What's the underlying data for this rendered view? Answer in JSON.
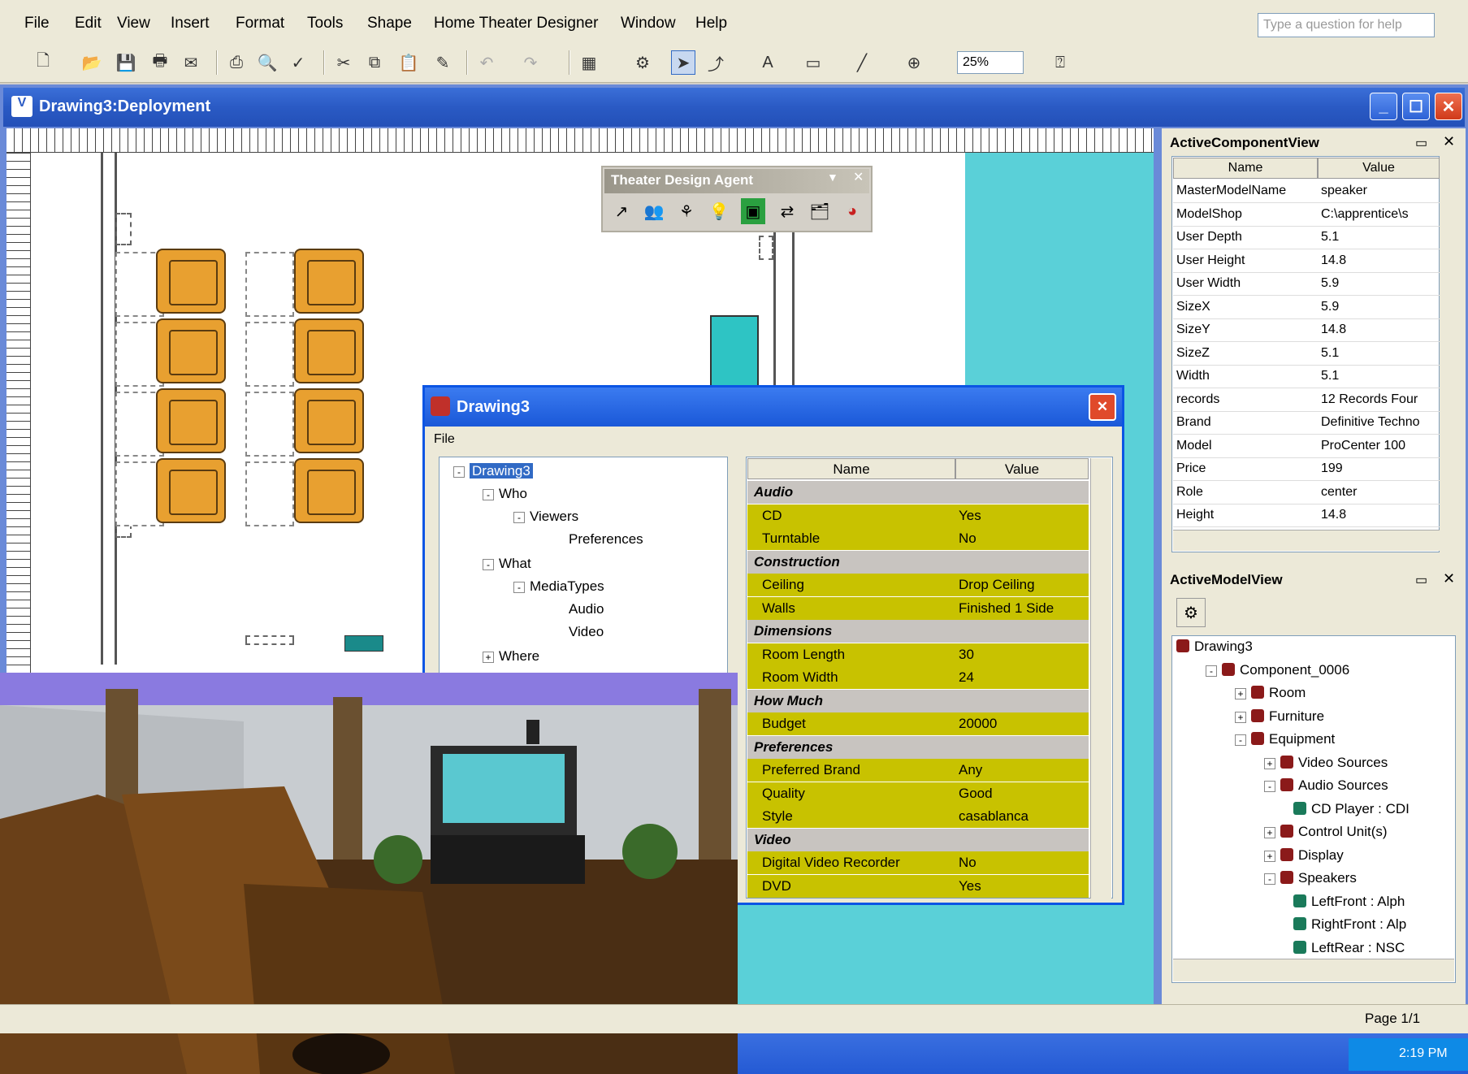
{
  "menubar": {
    "items": [
      "File",
      "Edit",
      "View",
      "Insert",
      "Format",
      "Tools",
      "Shape",
      "Home Theater Designer",
      "Window",
      "Help"
    ],
    "help_placeholder": "Type a question for help"
  },
  "toolbar": {
    "zoom": "25%",
    "icons": [
      "new-icon",
      "open-icon",
      "save-icon",
      "print-icon",
      "preview-icon",
      "cut-icon",
      "copy-icon",
      "paste-icon",
      "undo-icon",
      "redo-icon",
      "pointer-icon",
      "connector-icon",
      "text-icon",
      "rectangle-icon",
      "line-icon",
      "stamp-icon"
    ]
  },
  "document": {
    "title": "Drawing3:Deployment"
  },
  "agent": {
    "title": "Theater Design Agent"
  },
  "dialog": {
    "title": "Drawing3",
    "menu": "File",
    "tree": {
      "root": "Drawing3",
      "who": "Who",
      "viewers": "Viewers",
      "preferences": "Preferences",
      "what": "What",
      "mediatypes": "MediaTypes",
      "audio": "Audio",
      "video": "Video",
      "where": "Where"
    },
    "grid_headers": {
      "name": "Name",
      "value": "Value"
    },
    "rows": [
      {
        "type": "cat",
        "name": "Audio",
        "value": ""
      },
      {
        "type": "item",
        "name": "CD",
        "value": "Yes"
      },
      {
        "type": "item",
        "name": "Turntable",
        "value": "No"
      },
      {
        "type": "cat",
        "name": "Construction",
        "value": ""
      },
      {
        "type": "item",
        "name": "Ceiling",
        "value": "Drop Ceiling"
      },
      {
        "type": "item",
        "name": "Walls",
        "value": "Finished 1 Side"
      },
      {
        "type": "cat",
        "name": "Dimensions",
        "value": ""
      },
      {
        "type": "item",
        "name": "Room Length",
        "value": "30"
      },
      {
        "type": "item",
        "name": "Room Width",
        "value": "24"
      },
      {
        "type": "cat",
        "name": "How Much",
        "value": ""
      },
      {
        "type": "item",
        "name": "Budget",
        "value": "20000"
      },
      {
        "type": "cat",
        "name": "Preferences",
        "value": ""
      },
      {
        "type": "item",
        "name": "Preferred Brand",
        "value": "Any"
      },
      {
        "type": "item",
        "name": "Quality",
        "value": "Good"
      },
      {
        "type": "item",
        "name": "Style",
        "value": "casablanca"
      },
      {
        "type": "cat",
        "name": "Video",
        "value": ""
      },
      {
        "type": "item",
        "name": "Digital Video Recorder",
        "value": "No"
      },
      {
        "type": "item",
        "name": "DVD",
        "value": "Yes"
      }
    ]
  },
  "component_view": {
    "title": "ActiveComponentView",
    "headers": {
      "name": "Name",
      "value": "Value"
    },
    "rows": [
      {
        "name": "MasterModelName",
        "value": "speaker"
      },
      {
        "name": "ModelShop",
        "value": "C:\\apprentice\\s"
      },
      {
        "name": "User Depth",
        "value": "5.1"
      },
      {
        "name": "User Height",
        "value": "14.8"
      },
      {
        "name": "User Width",
        "value": "5.9"
      },
      {
        "name": "SizeX",
        "value": "5.9"
      },
      {
        "name": "SizeY",
        "value": "14.8"
      },
      {
        "name": "SizeZ",
        "value": "5.1"
      },
      {
        "name": "Width",
        "value": "5.1"
      },
      {
        "name": "records",
        "value": "12 Records Four"
      },
      {
        "name": "Brand",
        "value": "Definitive Techno"
      },
      {
        "name": "Model",
        "value": "ProCenter 100"
      },
      {
        "name": "Price",
        "value": "199"
      },
      {
        "name": "Role",
        "value": "center"
      },
      {
        "name": "Height",
        "value": "14.8"
      }
    ]
  },
  "model_view": {
    "title": "ActiveModelView",
    "nodes": [
      {
        "label": "Drawing3",
        "depth": 0,
        "exp": ""
      },
      {
        "label": "Component_0006",
        "depth": 1,
        "exp": "-"
      },
      {
        "label": "Room",
        "depth": 2,
        "exp": "+"
      },
      {
        "label": "Furniture",
        "depth": 2,
        "exp": "+"
      },
      {
        "label": "Equipment",
        "depth": 2,
        "exp": "-"
      },
      {
        "label": "Video Sources",
        "depth": 3,
        "exp": "+"
      },
      {
        "label": "Audio Sources",
        "depth": 3,
        "exp": "-"
      },
      {
        "label": "CD Player : CDI",
        "depth": 4,
        "exp": ""
      },
      {
        "label": "Control Unit(s)",
        "depth": 3,
        "exp": "+"
      },
      {
        "label": "Display",
        "depth": 3,
        "exp": "+"
      },
      {
        "label": "Speakers",
        "depth": 3,
        "exp": "-"
      },
      {
        "label": "LeftFront : Alph",
        "depth": 4,
        "exp": ""
      },
      {
        "label": "RightFront : Alp",
        "depth": 4,
        "exp": ""
      },
      {
        "label": "LeftRear : NSC",
        "depth": 4,
        "exp": ""
      }
    ]
  },
  "status": {
    "page": "Page 1/1"
  },
  "taskbar": {
    "time": "2:19 PM"
  }
}
